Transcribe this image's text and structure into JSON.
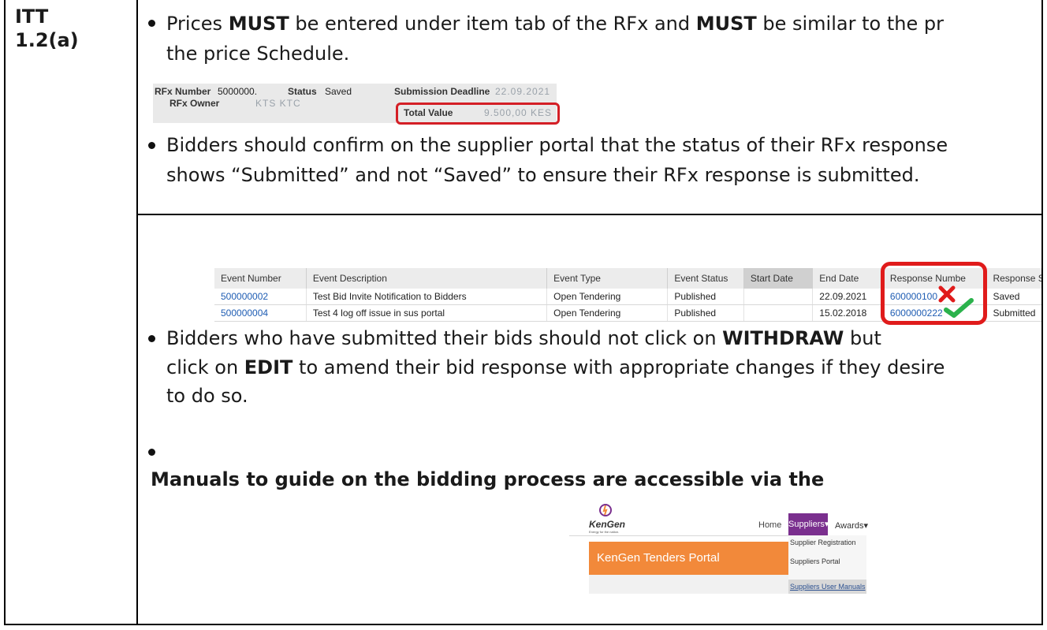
{
  "left_label": [
    "ITT",
    "1.2(a)"
  ],
  "row1": {
    "line1_pre": "Prices ",
    "line1_b1": "MUST",
    "line1_mid": " be entered under item tab of the RFx and ",
    "line1_b2": "MUST",
    "line1_post": " be similar to the pr",
    "line2": "the price Schedule."
  },
  "rfx_header": {
    "rfx_number_label": "RFx Number",
    "rfx_number_value": "5000000.",
    "status_label": "Status",
    "status_value": "Saved",
    "deadline_label": "Submission Deadline",
    "deadline_value": "22.09.2021",
    "owner_label": "RFx Owner",
    "owner_value": "KTS KTC",
    "total_label": "Total Value",
    "total_value": "9.500,00 KES"
  },
  "bullet2": {
    "line1": "Bidders should confirm on the supplier portal that the status of their RFx response",
    "line2": "shows “Submitted” and not “Saved” to ensure their RFx response is submitted."
  },
  "event_table": {
    "headers": [
      "Event Number",
      "Event Description",
      "Event Type",
      "Event Status",
      "Start Date",
      "End Date",
      "Response Numbe",
      "Response Status"
    ],
    "rows": [
      [
        "500000002",
        "Test Bid Invite Notification to Bidders",
        "Open Tendering",
        "Published",
        "",
        "22.09.2021",
        "600000100",
        "Saved"
      ],
      [
        "500000004",
        "Test 4 log off issue in sus portal",
        "Open Tendering",
        "Published",
        "",
        "15.02.2018",
        "6000000222",
        "Submitted"
      ]
    ]
  },
  "bullet3": {
    "line1_pre": "Bidders who have submitted their bids should not click on ",
    "line1_b": "WITHDRAW",
    "line1_post": " but",
    "line2_pre": "click on ",
    "line2_b": "EDIT",
    "line2_post": " to amend their bid response with appropriate changes if they desire",
    "line3": "to do so."
  },
  "manuals_heading": "Manuals to guide on the bidding process are accessible via the",
  "portal": {
    "logo_text": "KenGen",
    "tagline": "Energy for the nation.",
    "nav_home": "Home",
    "nav_suppliers": "Suppliers▾",
    "nav_awards": "Awards▾",
    "banner": "KenGen Tenders Portal",
    "menu": [
      "Supplier Registration",
      "Suppliers Portal",
      "Suppliers User Manuals"
    ]
  },
  "colors": {
    "highlight_red": "#e01b1b",
    "check_green": "#2bb24c",
    "portal_orange": "#f2893a",
    "portal_purple": "#7a2f8e",
    "link_blue": "#1f5db3"
  },
  "icons": [
    "cross-icon",
    "check-icon",
    "kengen-logo-icon"
  ]
}
